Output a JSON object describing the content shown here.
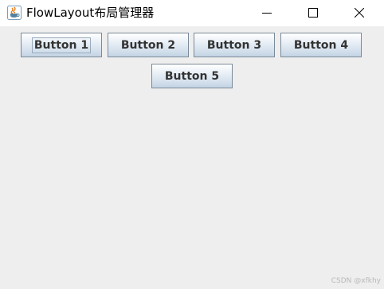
{
  "window": {
    "title": "FlowLayout布局管理器",
    "app_icon": "java-cup-icon",
    "controls": {
      "minimize_icon": "minimize-icon",
      "maximize_icon": "maximize-icon",
      "close_icon": "close-icon"
    }
  },
  "buttons": [
    {
      "label": "Button 1",
      "focused": true
    },
    {
      "label": "Button 2",
      "focused": false
    },
    {
      "label": "Button 3",
      "focused": false
    },
    {
      "label": "Button 4",
      "focused": false
    },
    {
      "label": "Button 5",
      "focused": false
    }
  ],
  "watermark": "CSDN @xfkhy",
  "colors": {
    "content_background": "#eeeeee",
    "titlebar_background": "#ffffff",
    "button_border": "#7a8a99",
    "button_text": "#333333"
  }
}
